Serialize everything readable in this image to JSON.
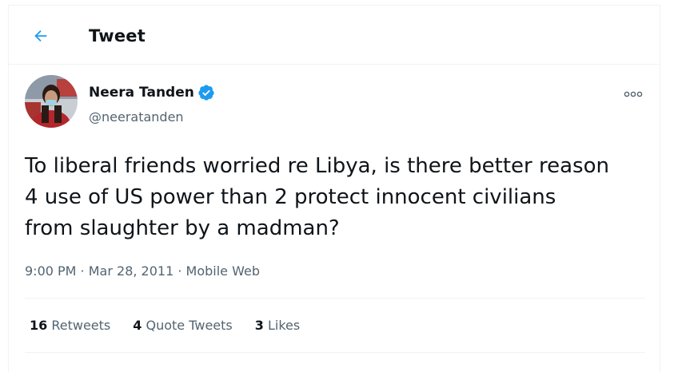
{
  "header": {
    "title": "Tweet",
    "back_icon": "arrow-left-icon"
  },
  "author": {
    "name": "Neera Tanden",
    "handle": "@neeratanden",
    "verified_icon": "verified-badge-icon"
  },
  "tweet": {
    "text": "To liberal friends worried re Libya, is there better reason\n4 use of US power than 2 protect innocent civilians\nfrom slaughter by a madman?",
    "time": "9:00 PM",
    "date": "Mar 28, 2011",
    "source": "Mobile Web",
    "separator": " · "
  },
  "stats": [
    {
      "count": "16",
      "label": "Retweets"
    },
    {
      "count": "4",
      "label": "Quote Tweets"
    },
    {
      "count": "3",
      "label": "Likes"
    }
  ],
  "colors": {
    "accent": "#1d9bf0",
    "text": "#0f1419",
    "secondary": "#536471",
    "border": "#eff3f4"
  }
}
